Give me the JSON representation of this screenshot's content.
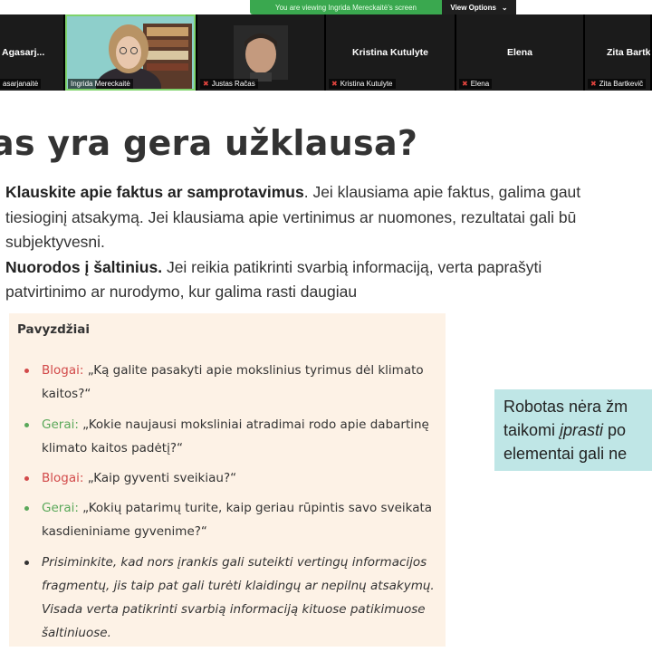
{
  "banner": {
    "message": "You are viewing Ingrida Mereckaitė's screen",
    "view_options_label": "View Options",
    "accent": "#3aa84f"
  },
  "gallery": {
    "participants": [
      {
        "big_name": "Agasarj...",
        "tag": "asarjanaitė",
        "muted": false
      },
      {
        "big_name": "",
        "tag": "Ingrida Mereckaitė",
        "muted": false
      },
      {
        "big_name": "",
        "tag": "Justas Račas",
        "muted": true
      },
      {
        "big_name": "Kristina Kutulyte",
        "tag": "Kristina Kutulyte",
        "muted": true
      },
      {
        "big_name": "Elena",
        "tag": "Elena",
        "muted": true
      },
      {
        "big_name": "Zita Bartk",
        "tag": "Zita Bartkevič",
        "muted": true
      }
    ]
  },
  "slide": {
    "title": "as yra gera užklausa?",
    "p1_bold": "Klauskite apie faktus ar samprotavimus",
    "p1_rest": ". Jei klausiama apie faktus, galima gaut",
    "p1_line2": "tiesioginį atsakymą. Jei klausiama apie vertinimus ar nuomones, rezultatai gali bū",
    "p1_line3": "subjektyvesni.",
    "p2_bold": "Nuorodos į šaltinius.",
    "p2_rest": " Jei reikia patikrinti svarbią informaciją, verta paprašyti",
    "p2_line2": "patvirtinimo ar nurodymo, kur galima rasti daugiau",
    "examples": {
      "title": "Pavyzdžiai",
      "items": [
        {
          "label": "Blogai:",
          "line1": " „Ką galite pasakyti apie mokslinius tyrimus dėl klimato",
          "line2": "kaitos?“"
        },
        {
          "label": "Gerai:",
          "line1": " „Kokie naujausi moksliniai atradimai rodo apie dabartinę",
          "line2": "klimato kaitos padėtį?“"
        },
        {
          "label": "Blogai:",
          "line1": " „Kaip gyventi sveikiau?“",
          "line2": ""
        },
        {
          "label": "Gerai:",
          "line1": " „Kokių patarimų turite, kaip geriau rūpintis savo sveikata",
          "line2": "kasdieniniame gyvenime?“"
        }
      ],
      "note": [
        "Prisiminkite, kad nors įrankis gali suteikti vertingų informacijos",
        "fragmentų, jis taip pat gali turėti klaidingų ar nepilnų atsakymų.",
        "Visada verta patikrinti svarbią informaciją kituose patikimuose",
        "šaltiniuose."
      ]
    },
    "callout": {
      "line1": "Robotas nėra žm",
      "line2_pre": "taikomi ",
      "line2_em": "įprasti",
      "line2_post": " po",
      "line3": "elementai gali ne"
    },
    "colors": {
      "bad": "#d24a4a",
      "good": "#5aa85a",
      "examples_bg": "#fdf2e6",
      "callout_bg": "#bfe6e6"
    }
  }
}
